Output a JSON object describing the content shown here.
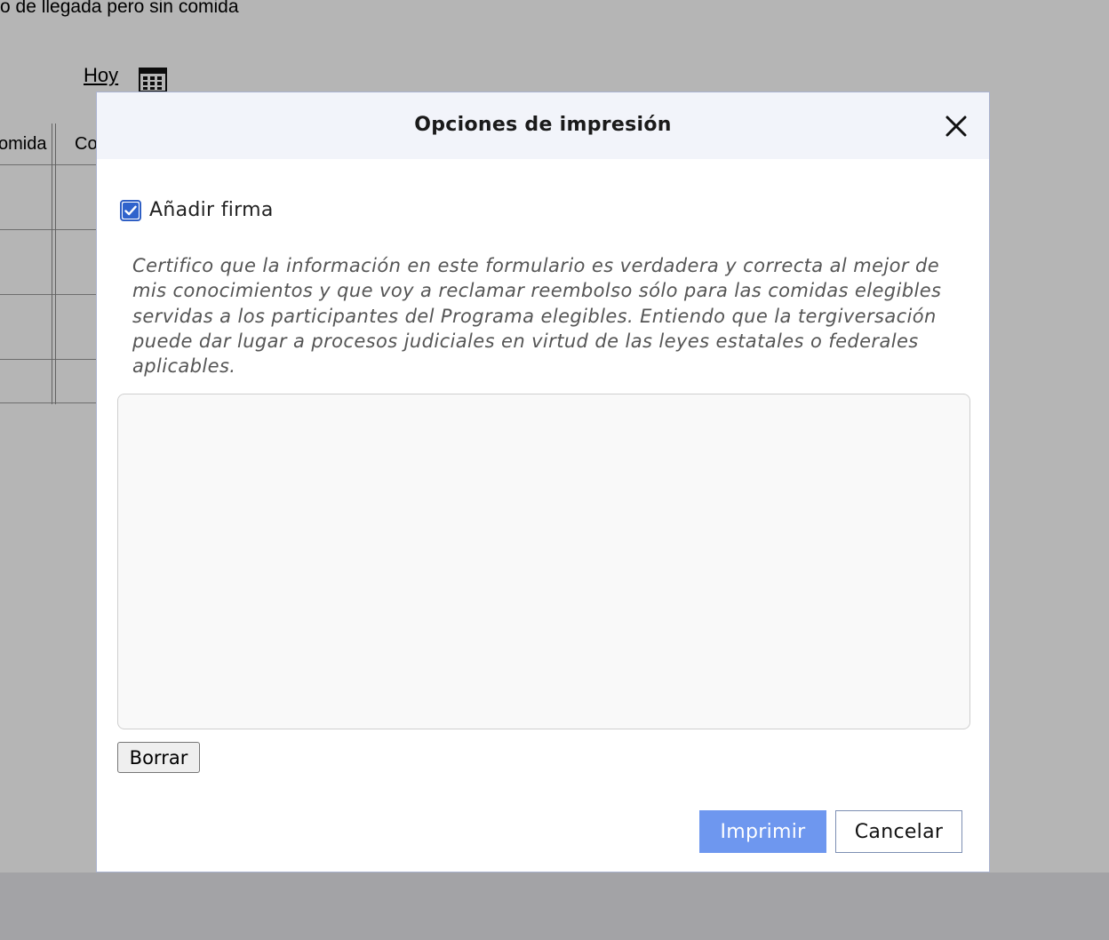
{
  "background": {
    "heading": "o de llegada pero sin comida",
    "today_link": "Hoy",
    "calendar_icon": "calendar-icon",
    "table": {
      "headers": [
        "omida",
        "Co"
      ]
    }
  },
  "dialog": {
    "title": "Opciones de impresión",
    "close_icon": "close-icon",
    "add_signature": {
      "label": "Añadir firma",
      "checked": true
    },
    "certification_text": "Certifico que la información en este formulario es verdadera y correcta al mejor de mis conocimientos y que voy a reclamar reembolso sólo para las comidas elegibles servidas a los participantes del Programa elegibles. Entiendo que la tergiversación puede dar lugar a procesos judiciales en virtud de las leyes estatales o federales aplicables.",
    "clear_label": "Borrar",
    "print_label": "Imprimir",
    "cancel_label": "Cancelar"
  },
  "colors": {
    "primary_button": "#6e97ef",
    "checkbox": "#2f63cc",
    "header_bg": "#f2f4fa",
    "overlay": "rgba(0,0,0,0.29)"
  }
}
